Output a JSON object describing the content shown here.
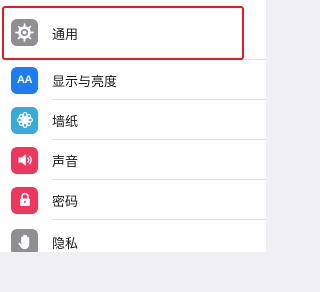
{
  "settings": {
    "items": [
      {
        "label": "通用",
        "icon": "gear-icon",
        "color": "#8e8e93"
      },
      {
        "label": "显示与亮度",
        "icon": "display-brightness-icon",
        "color": "#1e7cf2"
      },
      {
        "label": "墙纸",
        "icon": "wallpaper-flower-icon",
        "color": "#36aadc"
      },
      {
        "label": "声音",
        "icon": "speaker-icon",
        "color": "#f0365c"
      },
      {
        "label": "密码",
        "icon": "lock-icon",
        "color": "#f0365c"
      },
      {
        "label": "隐私",
        "icon": "hand-icon",
        "color": "#8e8e93"
      }
    ]
  },
  "highlight": {
    "color": "#e02020",
    "target": "通用"
  },
  "display_icon_text": "AA"
}
